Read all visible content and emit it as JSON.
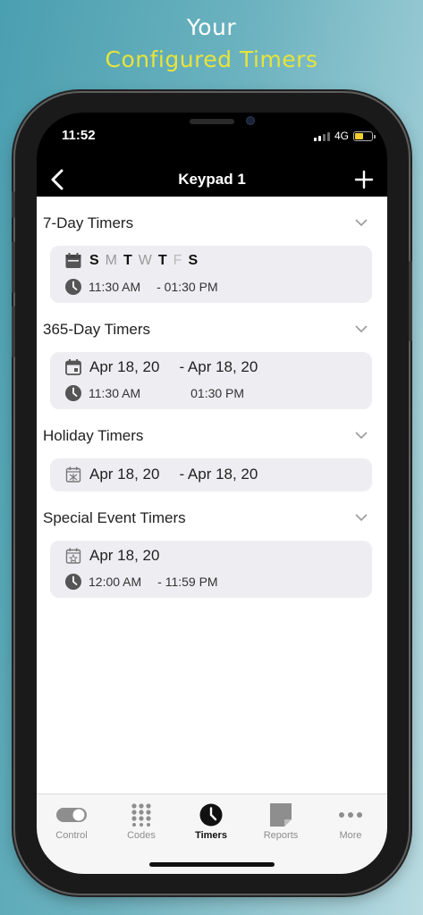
{
  "headline": {
    "line1": "Your",
    "line2": "Configured Timers"
  },
  "status_bar": {
    "time": "11:52",
    "network": "4G"
  },
  "navbar": {
    "title": "Keypad 1"
  },
  "sections": {
    "seven_day": {
      "title": "7-Day Timers",
      "days": [
        "S",
        "M",
        "T",
        "W",
        "T",
        "F",
        "S"
      ],
      "start_time": "11:30 AM",
      "end_time": "- 01:30 PM"
    },
    "year": {
      "title": "365-Day Timers",
      "start_date": "Apr 18, 20",
      "end_date": "-  Apr 18, 20",
      "start_time": "11:30 AM",
      "end_time": "01:30 PM"
    },
    "holiday": {
      "title": "Holiday Timers",
      "start_date": "Apr 18, 20",
      "end_date": "-  Apr 18, 20"
    },
    "special": {
      "title": "Special Event Timers",
      "date": "Apr 18, 20",
      "start_time": "12:00 AM",
      "end_time": "- 11:59 PM"
    }
  },
  "tabbar": {
    "control": "Control",
    "codes": "Codes",
    "timers": "Timers",
    "reports": "Reports",
    "more": "More"
  },
  "colors": {
    "accent_fab": "#6ec95a",
    "headline_accent": "#e7e43a"
  }
}
